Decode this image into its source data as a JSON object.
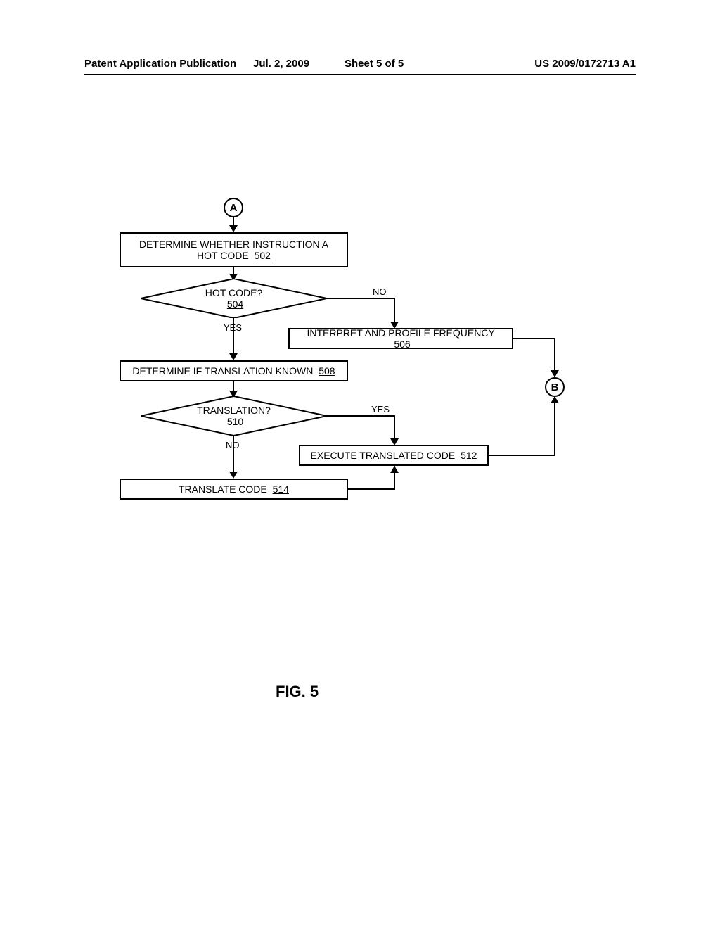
{
  "header": {
    "left": "Patent Application Publication",
    "date": "Jul. 2, 2009",
    "sheet": "Sheet 5 of 5",
    "right": "US 2009/0172713 A1"
  },
  "figure_label": "FIG. 5",
  "connectors": {
    "A": "A",
    "B": "B"
  },
  "labels": {
    "yes": "YES",
    "no": "NO"
  },
  "boxes": {
    "b502": {
      "text": "DETERMINE WHETHER INSTRUCTION A HOT CODE",
      "ref": "502"
    },
    "b506": {
      "text": "INTERPRET AND PROFILE FREQUENCY",
      "ref": "506"
    },
    "b508": {
      "text": "DETERMINE IF TRANSLATION KNOWN",
      "ref": "508"
    },
    "b512": {
      "text": "EXECUTE TRANSLATED CODE",
      "ref": "512"
    },
    "b514": {
      "text": "TRANSLATE CODE",
      "ref": "514"
    }
  },
  "decisions": {
    "d504": {
      "text": "HOT CODE?",
      "ref": "504"
    },
    "d510": {
      "text": "TRANSLATION?",
      "ref": "510"
    }
  },
  "chart_data": {
    "type": "flowchart",
    "title": "FIG. 5",
    "nodes": [
      {
        "id": "A",
        "type": "connector",
        "label": "A"
      },
      {
        "id": "502",
        "type": "process",
        "label": "DETERMINE WHETHER INSTRUCTION A HOT CODE 502"
      },
      {
        "id": "504",
        "type": "decision",
        "label": "HOT CODE? 504"
      },
      {
        "id": "506",
        "type": "process",
        "label": "INTERPRET AND PROFILE FREQUENCY 506"
      },
      {
        "id": "508",
        "type": "process",
        "label": "DETERMINE IF TRANSLATION KNOWN 508"
      },
      {
        "id": "510",
        "type": "decision",
        "label": "TRANSLATION? 510"
      },
      {
        "id": "512",
        "type": "process",
        "label": "EXECUTE TRANSLATED CODE 512"
      },
      {
        "id": "514",
        "type": "process",
        "label": "TRANSLATE CODE 514"
      },
      {
        "id": "B",
        "type": "connector",
        "label": "B"
      }
    ],
    "edges": [
      {
        "from": "A",
        "to": "502"
      },
      {
        "from": "502",
        "to": "504"
      },
      {
        "from": "504",
        "to": "506",
        "label": "NO"
      },
      {
        "from": "504",
        "to": "508",
        "label": "YES"
      },
      {
        "from": "508",
        "to": "510"
      },
      {
        "from": "510",
        "to": "512",
        "label": "YES"
      },
      {
        "from": "510",
        "to": "514",
        "label": "NO"
      },
      {
        "from": "514",
        "to": "512"
      },
      {
        "from": "512",
        "to": "B"
      },
      {
        "from": "506",
        "to": "B"
      }
    ]
  }
}
